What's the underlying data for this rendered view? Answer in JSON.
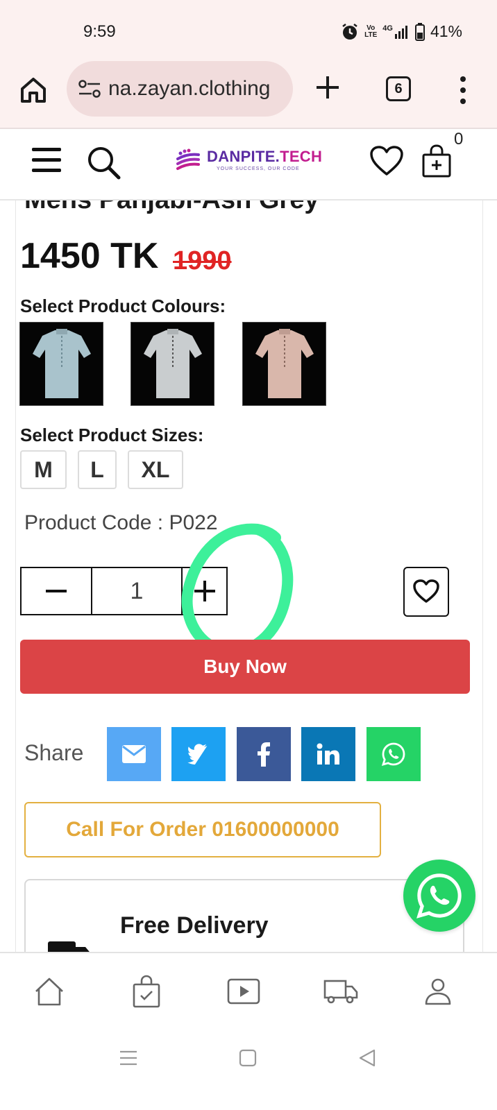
{
  "status_bar": {
    "time": "9:59",
    "volte": "Vo LTE",
    "network": "4G",
    "battery": "41%"
  },
  "browser": {
    "url": "na.zayan.clothing",
    "tab_count": "6"
  },
  "header": {
    "logo_name_primary": "DANPITE.",
    "logo_name_secondary": "TECH",
    "logo_tagline": "YOUR SUCCESS, OUR CODE",
    "cart_count": "0"
  },
  "product": {
    "title": "Mens Panjabi-Ash Grey",
    "price": "1450 TK",
    "old_price": "1990",
    "colours_label": "Select Product Colours:",
    "colour_swatches": [
      {
        "name": "Light Blue",
        "color": "#a9c3cc"
      },
      {
        "name": "Ash Grey",
        "color": "#c9cdcf"
      },
      {
        "name": "Peach",
        "color": "#d9b7ab"
      }
    ],
    "sizes_label": "Select Product Sizes:",
    "sizes": [
      "M",
      "L",
      "XL"
    ],
    "product_code": "Product Code : P022",
    "quantity": "1",
    "buy_now_label": "Buy Now",
    "share_label": "Share",
    "share_buttons": [
      {
        "name": "email",
        "color": "#57a8f5"
      },
      {
        "name": "twitter",
        "color": "#1da1f2"
      },
      {
        "name": "facebook",
        "color": "#3b5998"
      },
      {
        "name": "linkedin",
        "color": "#0a77b5"
      },
      {
        "name": "whatsapp",
        "color": "#25d366"
      }
    ],
    "call_label": "Call For Order 01600000000",
    "delivery_title": "Free Delivery"
  },
  "colors": {
    "accent_red": "#db4446",
    "old_price_red": "#e02424",
    "call_gold": "#e3a83a",
    "highlight_green": "#3df09a"
  },
  "bottom_nav": [
    "home-icon",
    "shopping-bag-icon",
    "video-icon",
    "delivery-truck-icon",
    "user-icon"
  ]
}
